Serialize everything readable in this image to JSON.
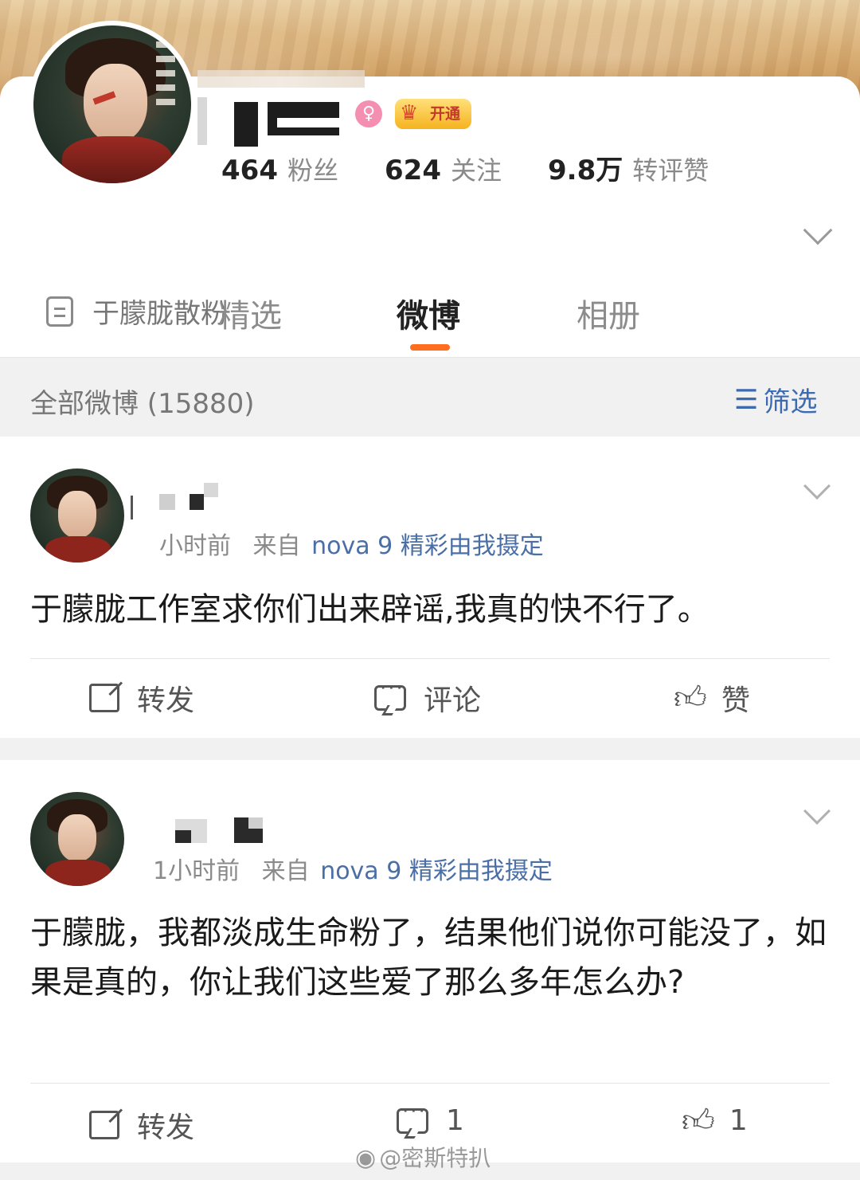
{
  "profile": {
    "vip_badge": "开通",
    "gender_symbol": "♀",
    "stats": [
      {
        "number": "464",
        "label": "粉丝"
      },
      {
        "number": "624",
        "label": "关注"
      },
      {
        "number": "9.8万",
        "label": "转评赞"
      }
    ],
    "intro": "于朦胧散粉"
  },
  "tabs": [
    {
      "label": "精选",
      "active": false
    },
    {
      "label": "微博",
      "active": true
    },
    {
      "label": "相册",
      "active": false
    }
  ],
  "filter_bar": {
    "title": "全部微博 (15880)",
    "filter_label": "筛选"
  },
  "posts": [
    {
      "time": "小时前",
      "from": "来自",
      "source": "nova 9 精彩由我摄定",
      "text": "于朦胧工作室求你们出来辟谣,我真的快不行了。",
      "repost_label": "转发",
      "comment_label": "评论",
      "like_label": "赞"
    },
    {
      "time": "1小时前",
      "from": "来自",
      "source": "nova 9 精彩由我摄定",
      "text": "于朦胧，我都淡成生命粉了，结果他们说你可能没了，如果是真的，你让我们这些爱了那么多年怎么办?",
      "repost_label": "转发",
      "comment_count": "1",
      "like_count": "1"
    }
  ],
  "watermark": "@密斯特扒",
  "colors": {
    "accent": "#ff6d1f",
    "link": "#4a6fa6",
    "filter": "#3d6bb2",
    "vip_gold": "#f5b31f"
  },
  "icons": {
    "intro": "document-icon",
    "filter": "filter-sort-icon",
    "repost": "repost-icon",
    "comment": "comment-icon",
    "like": "thumbs-up-icon",
    "more": "chevron-down-icon"
  }
}
